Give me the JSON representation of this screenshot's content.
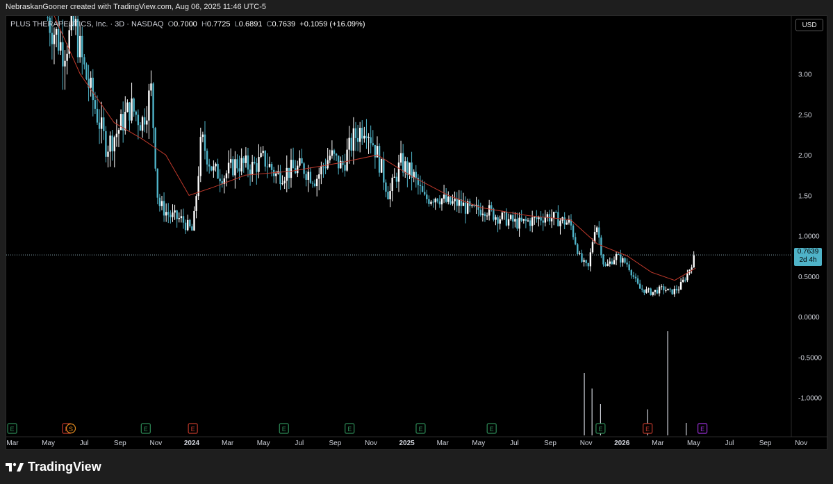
{
  "header": {
    "created": "NebraskanGooner created with TradingView.com, Aug 06, 2025 11:46 UTC-5"
  },
  "legend": {
    "symbol": "PLUS THERAPEUTICS, Inc. · 3D · NASDAQ",
    "o_label": "O",
    "o": "0.7000",
    "h_label": "H",
    "h": "0.7725",
    "l_label": "L",
    "l": "0.6891",
    "c_label": "C",
    "c": "0.7639",
    "change": "+0.1059 (+16.09%)"
  },
  "currency": "USD",
  "price_tag": {
    "price": "0.7639",
    "countdown": "2d 4h"
  },
  "brand": {
    "name": "TradingView"
  },
  "colors": {
    "up": "#ffffff",
    "down": "#4fb3c8",
    "ma": "#c0392b",
    "background": "#000000",
    "earnings_green": "#2e8b57",
    "earnings_red": "#c0392b",
    "earnings_purple": "#9b30d9",
    "dividend_orange": "#e08a1e"
  },
  "chart_data": {
    "type": "candlestick",
    "title": "PLUS THERAPEUTICS, Inc. · 3D · NASDAQ",
    "ylim": [
      -1.45,
      3.65
    ],
    "y_ticks": [
      3.0,
      2.5,
      2.0,
      1.5,
      1.0,
      0.5,
      0.0,
      -0.5,
      -1.0
    ],
    "y_tick_labels": [
      "3.00",
      "2.50",
      "2.00",
      "1.50",
      "1.0000",
      "0.5000",
      "0.0000",
      "-0.5000",
      "-1.0000"
    ],
    "x_tick_labels": [
      "Mar",
      "May",
      "Jul",
      "Sep",
      "Nov",
      "2024",
      "Mar",
      "May",
      "Jul",
      "Sep",
      "Nov",
      "2025",
      "Mar",
      "May",
      "Jul",
      "Sep",
      "Nov",
      "2026",
      "Mar",
      "May",
      "Jul",
      "Sep",
      "Nov"
    ],
    "last_price": 0.7639,
    "price_points": [
      [
        "2023-04-20",
        3.7
      ],
      [
        "2023-05-10",
        3.3
      ],
      [
        "2023-05-25",
        3.6
      ],
      [
        "2023-06-05",
        3.1
      ],
      [
        "2023-06-20",
        2.6
      ],
      [
        "2023-07-05",
        2.1
      ],
      [
        "2023-07-20",
        2.3
      ],
      [
        "2023-08-05",
        2.6
      ],
      [
        "2023-08-20",
        2.4
      ],
      [
        "2023-09-01",
        2.8
      ],
      [
        "2023-09-10",
        1.4
      ],
      [
        "2023-09-25",
        1.25
      ],
      [
        "2023-10-10",
        1.2
      ],
      [
        "2023-10-25",
        1.05
      ],
      [
        "2023-11-05",
        2.2
      ],
      [
        "2023-11-20",
        1.8
      ],
      [
        "2023-12-05",
        1.75
      ],
      [
        "2023-12-20",
        1.9
      ],
      [
        "2024-01-10",
        1.85
      ],
      [
        "2024-01-25",
        1.95
      ],
      [
        "2024-02-10",
        1.75
      ],
      [
        "2024-02-25",
        1.8
      ],
      [
        "2024-03-15",
        1.85
      ],
      [
        "2024-04-01",
        1.7
      ],
      [
        "2024-04-20",
        2.0
      ],
      [
        "2024-05-05",
        1.85
      ],
      [
        "2024-05-20",
        2.2
      ],
      [
        "2024-06-05",
        2.4
      ],
      [
        "2024-06-20",
        2.0
      ],
      [
        "2024-07-05",
        1.5
      ],
      [
        "2024-07-20",
        1.9
      ],
      [
        "2024-08-05",
        1.75
      ],
      [
        "2024-08-20",
        1.45
      ],
      [
        "2024-09-05",
        1.5
      ],
      [
        "2024-09-20",
        1.4
      ],
      [
        "2024-10-05",
        1.4
      ],
      [
        "2024-10-20",
        1.3
      ],
      [
        "2024-11-05",
        1.35
      ],
      [
        "2024-11-20",
        1.25
      ],
      [
        "2024-12-05",
        1.2
      ],
      [
        "2024-12-20",
        1.15
      ],
      [
        "2025-01-10",
        1.2
      ],
      [
        "2025-01-25",
        1.25
      ],
      [
        "2025-02-10",
        1.2
      ],
      [
        "2025-02-25",
        1.15
      ],
      [
        "2025-03-10",
        0.7
      ],
      [
        "2025-03-20",
        0.6
      ],
      [
        "2025-03-30",
        1.2
      ],
      [
        "2025-04-10",
        0.6
      ],
      [
        "2025-04-25",
        0.75
      ],
      [
        "2025-05-10",
        0.65
      ],
      [
        "2025-05-25",
        0.35
      ],
      [
        "2025-06-10",
        0.3
      ],
      [
        "2025-06-25",
        0.35
      ],
      [
        "2025-07-05",
        0.3
      ],
      [
        "2025-07-15",
        0.35
      ],
      [
        "2025-07-25",
        0.5
      ],
      [
        "2025-08-06",
        0.7639
      ]
    ],
    "moving_average": [
      [
        "2023-04-20",
        3.9
      ],
      [
        "2023-06-01",
        3.0
      ],
      [
        "2023-07-15",
        2.4
      ],
      [
        "2023-08-20",
        2.2
      ],
      [
        "2023-09-20",
        2.0
      ],
      [
        "2023-10-20",
        1.5
      ],
      [
        "2023-11-20",
        1.6
      ],
      [
        "2024-01-01",
        1.75
      ],
      [
        "2024-03-01",
        1.8
      ],
      [
        "2024-05-01",
        1.9
      ],
      [
        "2024-06-20",
        2.0
      ],
      [
        "2024-08-01",
        1.75
      ],
      [
        "2024-09-20",
        1.5
      ],
      [
        "2024-11-01",
        1.35
      ],
      [
        "2025-01-01",
        1.25
      ],
      [
        "2025-02-25",
        1.2
      ],
      [
        "2025-04-01",
        0.9
      ],
      [
        "2025-05-10",
        0.75
      ],
      [
        "2025-06-10",
        0.55
      ],
      [
        "2025-07-10",
        0.45
      ],
      [
        "2025-08-06",
        0.6
      ]
    ],
    "volume_spikes": [
      [
        "2025-03-15",
        0.6
      ],
      [
        "2025-03-25",
        0.45
      ],
      [
        "2025-04-05",
        0.3
      ],
      [
        "2025-06-05",
        0.25
      ],
      [
        "2025-07-01",
        1.0
      ],
      [
        "2025-07-25",
        0.12
      ]
    ],
    "event_markers": [
      {
        "date": "2023-03-05",
        "label": "E",
        "kind": "earnings_green"
      },
      {
        "date": "2023-05-15",
        "label": "E",
        "kind": "earnings_red"
      },
      {
        "date": "2023-05-20",
        "label": "S",
        "kind": "dividend_orange"
      },
      {
        "date": "2023-08-25",
        "label": "E",
        "kind": "earnings_green"
      },
      {
        "date": "2023-10-25",
        "label": "E",
        "kind": "earnings_red"
      },
      {
        "date": "2024-02-20",
        "label": "E",
        "kind": "earnings_green"
      },
      {
        "date": "2024-05-15",
        "label": "E",
        "kind": "earnings_green"
      },
      {
        "date": "2024-08-15",
        "label": "E",
        "kind": "earnings_green"
      },
      {
        "date": "2024-11-15",
        "label": "E",
        "kind": "earnings_green"
      },
      {
        "date": "2025-04-05",
        "label": "E",
        "kind": "earnings_green"
      },
      {
        "date": "2025-06-05",
        "label": "E",
        "kind": "earnings_red"
      },
      {
        "date": "2025-08-15",
        "label": "E",
        "kind": "earnings_purple"
      }
    ]
  }
}
